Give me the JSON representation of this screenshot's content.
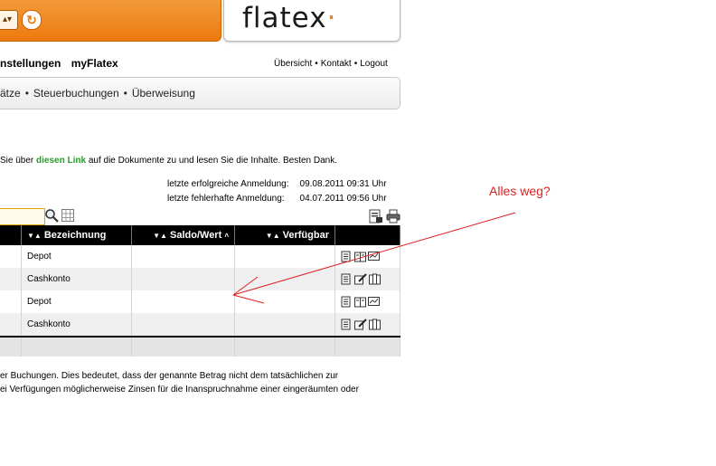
{
  "header": {
    "logo_text": "flatex",
    "logo_dot": "·",
    "select_label": "▴▾",
    "refresh_label": "↻",
    "brand_color": "#f07e10"
  },
  "main_menu": {
    "items": [
      "nstellungen",
      "myFlatex"
    ]
  },
  "top_links": {
    "items": [
      "Übersicht",
      "Kontakt",
      "Logout"
    ],
    "separator": "•"
  },
  "sub_menu": {
    "items": [
      "ätze",
      "Steuerbuchungen",
      "Überweisung"
    ],
    "separator": "•"
  },
  "notice": {
    "before": "Sie über ",
    "link": "diesen Link",
    "after": " auf die Dokumente zu und lesen Sie die Inhalte. Besten Dank."
  },
  "login_info": {
    "rows": [
      {
        "label": "letzte erfolgreiche Anmeldung:",
        "value": "09.08.2011 09:31 Uhr"
      },
      {
        "label": "letzte fehlerhafte Anmeldung:",
        "value": "04.07.2011 09:56 Uhr"
      }
    ]
  },
  "toolbar": {
    "search_value": "",
    "icons": [
      "search-icon",
      "grid-icon",
      "export-icon",
      "print-icon"
    ]
  },
  "table": {
    "columns": [
      {
        "label": "",
        "sortable": false
      },
      {
        "label": "Bezeichnung",
        "sortable": true
      },
      {
        "label": "Saldo/Wert",
        "sortable": true,
        "marker": "˄"
      },
      {
        "label": "Verfügbar",
        "sortable": true
      },
      {
        "label": "",
        "sortable": false
      }
    ],
    "sort_arrows": "▼▲",
    "rows": [
      {
        "name": "Depot",
        "saldo": "",
        "verfuegbar": "",
        "actions": [
          "document-icon",
          "book-icon",
          "chart-icon"
        ]
      },
      {
        "name": "Cashkonto",
        "saldo": "",
        "verfuegbar": "",
        "actions": [
          "document-icon",
          "edit-icon",
          "files-icon"
        ]
      },
      {
        "name": "Depot",
        "saldo": "",
        "verfuegbar": "",
        "actions": [
          "document-icon",
          "book-icon",
          "chart-icon"
        ]
      },
      {
        "name": "Cashkonto",
        "saldo": "",
        "verfuegbar": "",
        "actions": [
          "document-icon",
          "edit-icon",
          "files-icon"
        ]
      }
    ]
  },
  "footnote": {
    "lines": [
      "er Buchungen. Dies bedeutet, dass der genannte Betrag nicht dem tatsächlichen zur",
      "ei Verfügungen möglicherweise Zinsen für die Inanspruchnahme einer eingeräumten oder"
    ]
  },
  "annotation": {
    "text": "Alles weg?",
    "color": "#e02020"
  }
}
